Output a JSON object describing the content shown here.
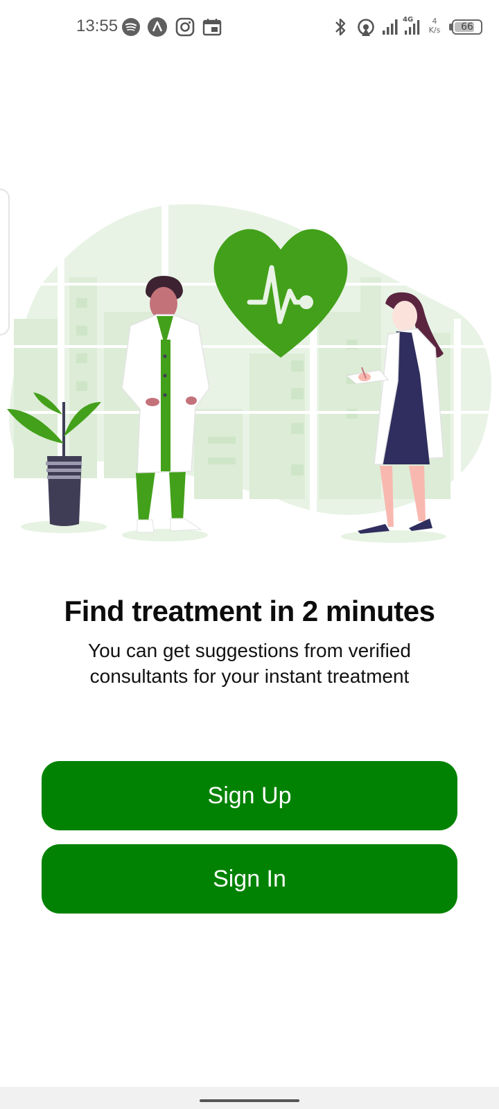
{
  "status_bar": {
    "time": "13:55",
    "left_icons": [
      "spotify-icon",
      "app-icon",
      "instagram-icon",
      "calendar-icon"
    ],
    "right_icons": [
      "bluetooth-icon",
      "hotspot-icon",
      "signal-icon",
      "signal-4g-icon"
    ],
    "network_speed_value": "4",
    "network_speed_unit": "K/s",
    "battery": "66",
    "network_type": "4G"
  },
  "main": {
    "headline": "Find treatment in 2 minutes",
    "subtitle": "You can get suggestions from verified consultants for your instant treatment"
  },
  "buttons": {
    "sign_up": "Sign Up",
    "sign_in": "Sign In"
  },
  "colors": {
    "primary_button": "#028202",
    "illustration_green": "#43a01a",
    "background_green": "#e9f3e6"
  }
}
